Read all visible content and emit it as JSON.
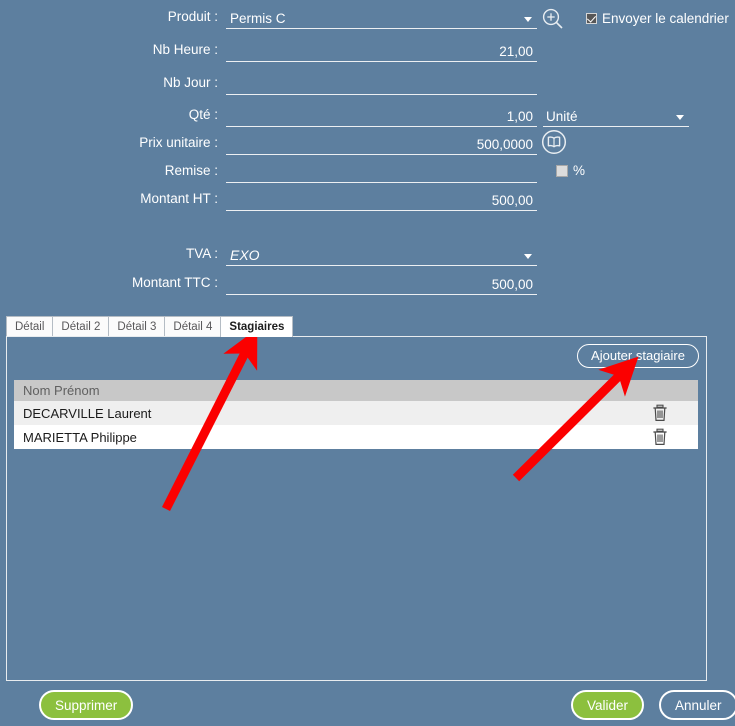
{
  "theme": {
    "background": "#5d7f9f",
    "accent_green": "#8cc03e",
    "annotation_red": "#fb0000",
    "field_line": "#eceff2",
    "grid_header_bg": "#c8c8c8"
  },
  "form": {
    "rows": [
      {
        "label": "Produit :",
        "value": "Permis C",
        "align": "left",
        "type": "select",
        "italic": false
      },
      {
        "label": "Nb Heure :",
        "value": "21,00",
        "align": "right",
        "type": "text",
        "italic": false
      },
      {
        "label": "Nb Jour :",
        "value": "",
        "align": "right",
        "type": "text",
        "italic": false
      },
      {
        "label": "Qté :",
        "value": "1,00",
        "align": "right",
        "type": "text",
        "italic": false
      },
      {
        "label": "Prix unitaire :",
        "value": "500,0000",
        "align": "right",
        "type": "text",
        "italic": false
      },
      {
        "label": "Remise :",
        "value": "",
        "align": "right",
        "type": "text",
        "italic": false
      },
      {
        "label": "Montant HT :",
        "value": "500,00",
        "align": "right",
        "type": "text",
        "italic": false
      },
      {
        "label": "TVA :",
        "value": "EXO",
        "align": "left",
        "type": "select",
        "italic": true
      },
      {
        "label": "Montant TTC :",
        "value": "500,00",
        "align": "right",
        "type": "text",
        "italic": false
      }
    ],
    "unit_select": {
      "value": "Unité"
    },
    "zoom_icon": "magnifier-plus-icon",
    "book_icon": "book-icon",
    "send_calendar": {
      "label": "Envoyer le calendrier",
      "checked": true
    },
    "percent": {
      "label": "%",
      "checked": false
    }
  },
  "tabs": [
    {
      "label": "Détail",
      "active": false
    },
    {
      "label": "Détail 2",
      "active": false
    },
    {
      "label": "Détail 3",
      "active": false
    },
    {
      "label": "Détail 4",
      "active": false
    },
    {
      "label": "Stagiaires",
      "active": true
    }
  ],
  "panel": {
    "add_button": "Ajouter stagiaire",
    "grid": {
      "columns": [
        "Nom Prénom"
      ],
      "rows": [
        {
          "name": "DECARVILLE Laurent",
          "delete_icon": "trash-icon"
        },
        {
          "name": "MARIETTA Philippe",
          "delete_icon": "trash-icon"
        }
      ]
    }
  },
  "footer": {
    "delete_label": "Supprimer",
    "validate_label": "Valider",
    "cancel_label": "Annuler"
  },
  "annotations": [
    {
      "name": "arrow-to-stagiaires-tab",
      "from": [
        166,
        509
      ],
      "to": [
        254,
        335
      ]
    },
    {
      "name": "arrow-to-add-stagiaire-btn",
      "from": [
        516,
        478
      ],
      "to": [
        632,
        362
      ]
    }
  ]
}
